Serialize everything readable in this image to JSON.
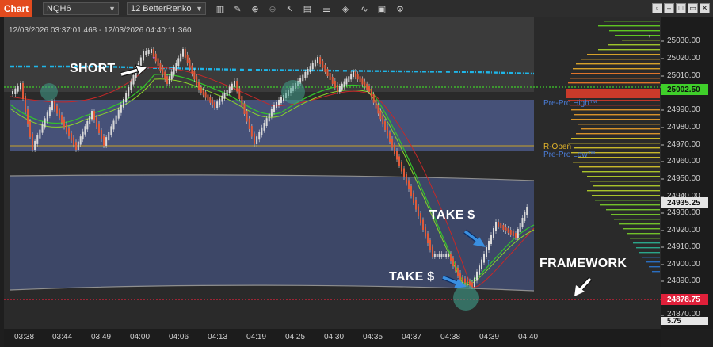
{
  "toolbar": {
    "chart_tab": "Chart",
    "instrument": "NQH6",
    "bar_type": "12 BetterRenko"
  },
  "chart": {
    "time_range": "12/03/2026 03:37:01.468 - 12/03/2026 04:40:11.360",
    "panel_label": "F"
  },
  "annotations": {
    "short": "SHORT",
    "take_1": "TAKE $",
    "take_2": "TAKE $",
    "framework": "FRAMEWORK"
  },
  "levels": {
    "pre_pro_high": "Pre-Pro High™",
    "r_open": "R-Open",
    "pre_pro_low": "Pre-Pro Low™"
  },
  "price_axis": {
    "ticks": [
      "25030.00",
      "25020.00",
      "25010.00",
      "24990.00",
      "24980.00",
      "24970.00",
      "24960.00",
      "24950.00",
      "24940.00",
      "24930.00",
      "24920.00",
      "24910.00",
      "24900.00",
      "24890.00",
      "24870.00"
    ],
    "green_tag": "25002.50",
    "white_tag": "24935.25",
    "red_tag": "24878.75",
    "bottom_partial": "5.75"
  },
  "time_axis": {
    "ticks": [
      "03:38",
      "03:44",
      "03:49",
      "04:00",
      "04:06",
      "04:13",
      "04:19",
      "04:25",
      "04:30",
      "04:35",
      "04:37",
      "04:38",
      "04:39",
      "04:40"
    ]
  },
  "colors": {
    "accent_tab": "#e34b1e",
    "cyan_line": "#1fb6e8",
    "green_dotted": "#3fcf2a",
    "red_dotted": "#e0203a",
    "zone_fill": "#4a5a8a"
  }
}
